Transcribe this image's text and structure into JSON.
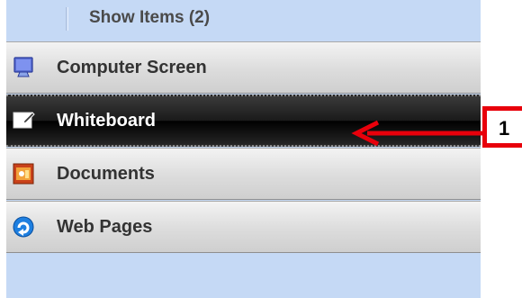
{
  "header": {
    "title": "Show Items (2)"
  },
  "items": [
    {
      "label": "Computer Screen",
      "icon": "monitor-icon"
    },
    {
      "label": "Whiteboard",
      "icon": "whiteboard-icon",
      "active": true
    },
    {
      "label": "Documents",
      "icon": "document-icon"
    },
    {
      "label": "Web Pages",
      "icon": "web-globe-icon"
    }
  ],
  "annotation": {
    "number": "1",
    "color": "#e8000b"
  },
  "colors": {
    "panel_bg": "#c5d9f5",
    "active_bg": "#111111"
  }
}
